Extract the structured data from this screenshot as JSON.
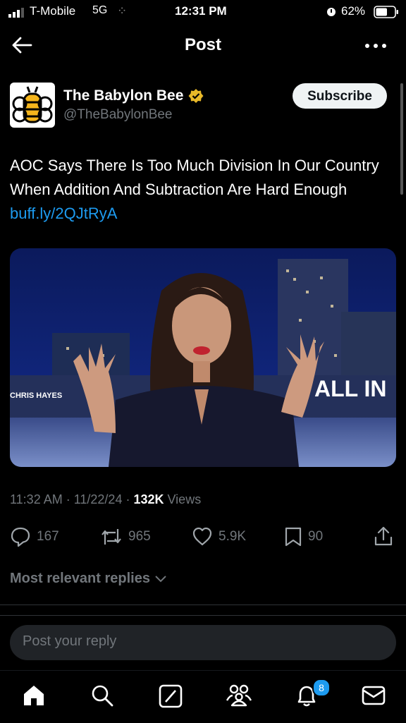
{
  "status_bar": {
    "carrier": "T-Mobile",
    "network": "5G",
    "time": "12:31 PM",
    "battery": "62%",
    "battery_level": 0.62
  },
  "header": {
    "title": "Post",
    "back_icon": "arrow-left-icon",
    "more_icon": "more-horizontal-icon"
  },
  "post": {
    "author_name": "The Babylon Bee",
    "author_handle": "@TheBabylonBee",
    "verified_color": "#e8b829",
    "subscribe_label": "Subscribe",
    "text": "AOC Says There Is Too Much Division In Our Country When Addition And Subtraction Are Hard Enough ",
    "link": "buff.ly/2QJtRyA",
    "media_overlay_text_1": "CHRIS HAYES",
    "media_overlay_text_2": "ALL IN",
    "time": "11:32 AM",
    "date": "11/22/24",
    "views_count": "132K",
    "views_label": "Views"
  },
  "actions": {
    "replies": "167",
    "reposts": "965",
    "likes": "5.9K",
    "bookmarks": "90"
  },
  "replies_sort": {
    "label": "Most relevant replies"
  },
  "reply_input": {
    "placeholder": "Post your reply"
  },
  "tabbar": {
    "notifications_badge": "8"
  },
  "colors": {
    "accent": "#1d9bf0",
    "muted": "#71767b",
    "background": "#000000"
  }
}
